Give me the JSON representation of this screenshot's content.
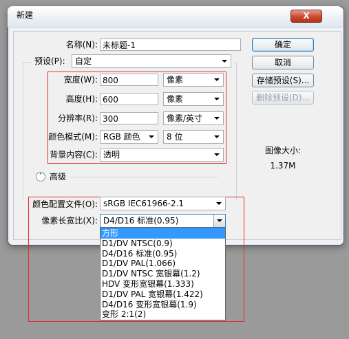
{
  "window": {
    "title": "新建",
    "close_label": "X"
  },
  "form": {
    "name_label": "名称(N):",
    "name_value": "未标题-1",
    "preset_label": "预设(P):",
    "preset_value": "自定",
    "width_label": "宽度(W):",
    "width_value": "800",
    "width_unit": "像素",
    "height_label": "高度(H):",
    "height_value": "600",
    "height_unit": "像素",
    "resolution_label": "分辨率(R):",
    "resolution_value": "300",
    "resolution_unit": "像素/英寸",
    "color_mode_label": "颜色模式(M):",
    "color_mode_value": "RGB 颜色",
    "bit_depth_value": "8 位",
    "background_label": "背景内容(C):",
    "background_value": "透明",
    "advanced_label": "高级",
    "color_profile_label": "颜色配置文件(O):",
    "color_profile_value": "sRGB IEC61966-2.1",
    "pixel_aspect_label": "像素长宽比(X):",
    "pixel_aspect_value": "D4/D16 标准(0.95)"
  },
  "buttons": {
    "ok": "确定",
    "cancel": "取消",
    "save_preset": "存储预设(S)...",
    "delete_preset": "删除预设(D)..."
  },
  "image_size": {
    "label": "图像大小:",
    "value": "1.37M"
  },
  "pixel_aspect_options": [
    "方形",
    "D1/DV NTSC(0.9)",
    "D4/D16 标准(0.95)",
    "D1/DV PAL(1.066)",
    "D1/DV NTSC 宽银幕(1.2)",
    "HDV 变形宽银幕(1.333)",
    "D1/DV PAL 宽银幕(1.422)",
    "D4/D16 变形宽银幕(1.9)",
    "变形 2:1(2)"
  ],
  "colors": {
    "highlight": "#3399ff",
    "annotation_red": "#e0302a",
    "close_red": "#c9492f"
  }
}
